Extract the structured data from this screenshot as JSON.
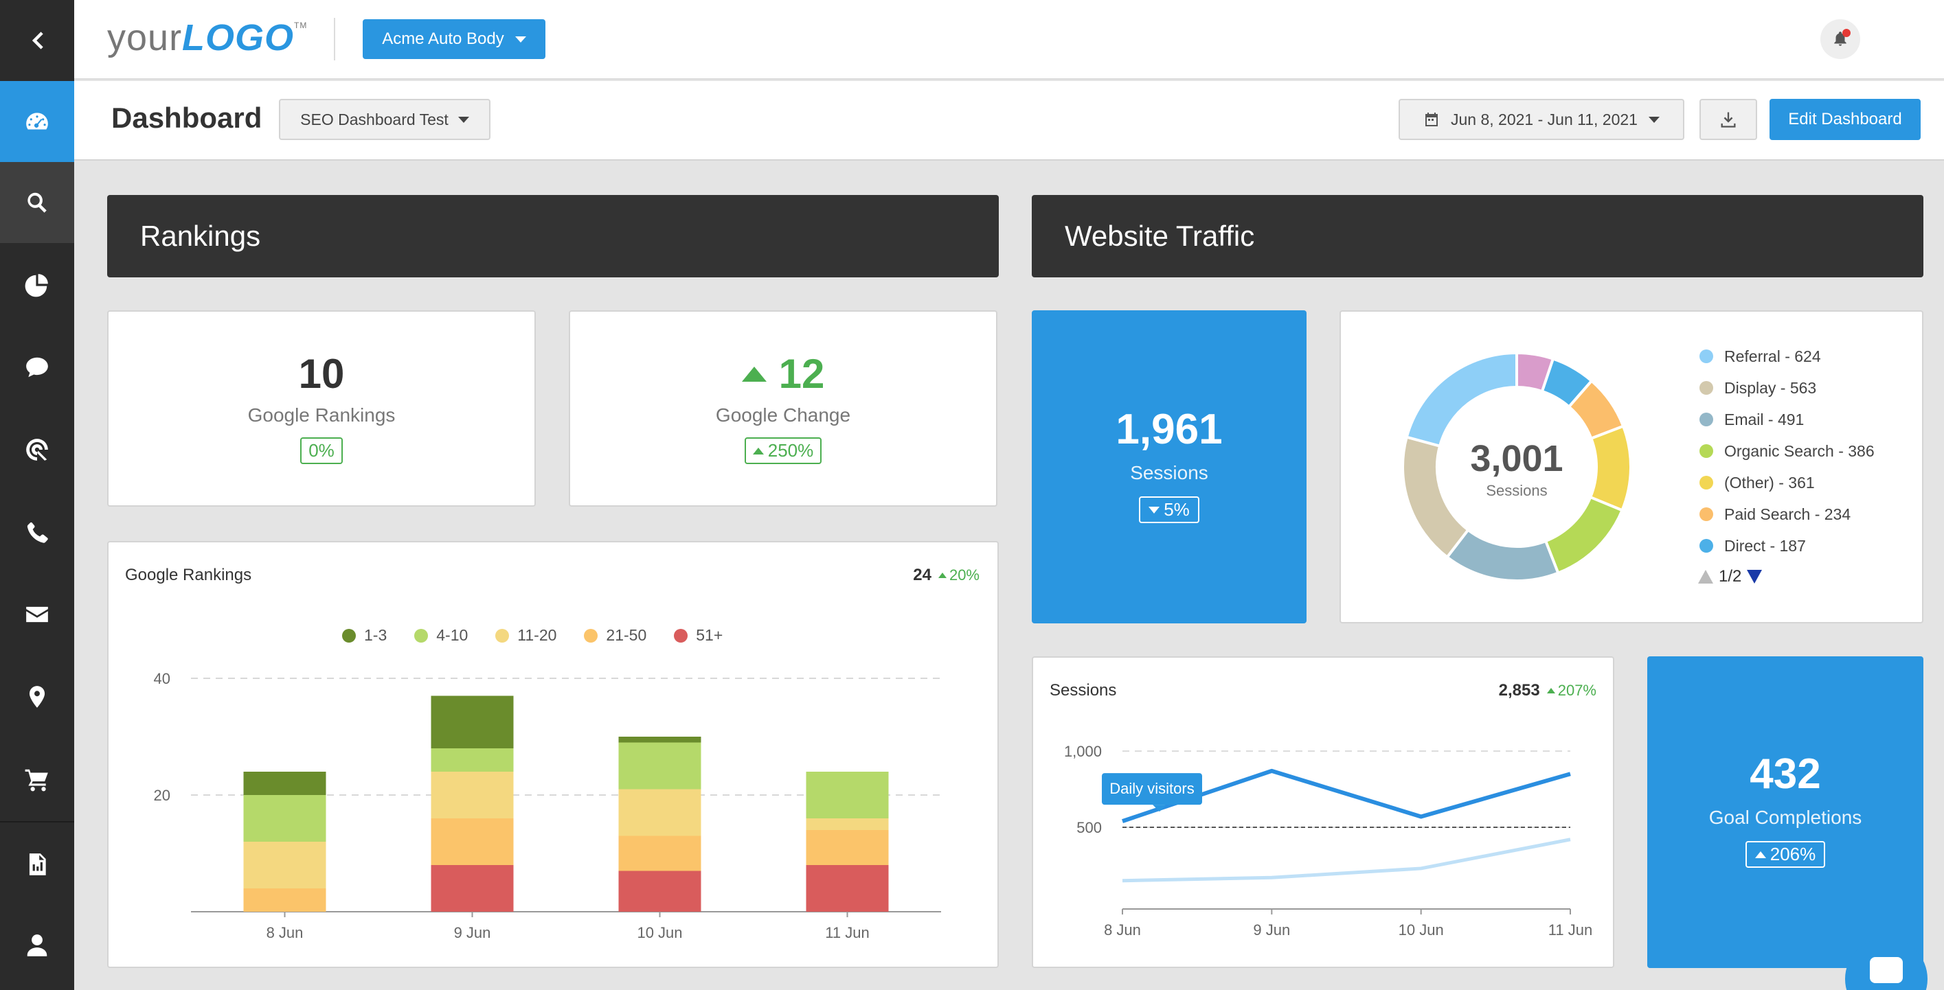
{
  "logo": {
    "text1": "your",
    "text2": "LOGO",
    "tm": "TM"
  },
  "client": {
    "label": "Acme Auto Body"
  },
  "header": {
    "title": "Dashboard",
    "dashboard_select": "SEO Dashboard Test",
    "date_range": "Jun 8, 2021 - Jun 11, 2021",
    "edit_label": "Edit Dashboard"
  },
  "sidebar": {
    "items": [
      {
        "icon": "chevron-left-icon"
      },
      {
        "icon": "dashboard-gauge-icon",
        "active": true
      },
      {
        "icon": "search-icon"
      },
      {
        "icon": "pie-chart-icon"
      },
      {
        "icon": "chat-icon"
      },
      {
        "icon": "target-icon"
      },
      {
        "icon": "phone-icon"
      },
      {
        "icon": "envelope-icon"
      },
      {
        "icon": "map-pin-icon"
      },
      {
        "icon": "cart-icon"
      },
      {
        "icon": "report-icon"
      },
      {
        "icon": "user-icon"
      }
    ]
  },
  "rankings": {
    "section_title": "Rankings",
    "google_rankings": {
      "value": "10",
      "label": "Google Rankings",
      "change": "0%"
    },
    "google_change": {
      "value": "12",
      "label": "Google Change",
      "change": "250%"
    },
    "chart": {
      "title": "Google Rankings",
      "total": "24",
      "change": "20%"
    }
  },
  "traffic": {
    "section_title": "Website Traffic",
    "sessions_card": {
      "value": "1,961",
      "label": "Sessions",
      "change": "5%"
    },
    "donut": {
      "center_value": "3,001",
      "center_label": "Sessions",
      "legend": [
        "Referral - 624",
        "Display - 563",
        "Email - 491",
        "Organic Search - 386",
        "(Other) - 361",
        "Paid Search - 234",
        "Direct - 187"
      ],
      "pager": "1/2"
    },
    "sessions_chart": {
      "title": "Sessions",
      "total": "2,853",
      "change": "207%",
      "tooltip": "Daily visitors"
    },
    "goal_card": {
      "value": "432",
      "label": "Goal Completions",
      "change": "206%"
    }
  },
  "colors": {
    "accent": "#2a96e0",
    "sidebar": "#2b2b2b",
    "section_header": "#333333",
    "positive": "#4caf50"
  },
  "chart_data": [
    {
      "type": "bar",
      "stacked": true,
      "title": "Google Rankings",
      "categories": [
        "8 Jun",
        "9 Jun",
        "10 Jun",
        "11 Jun"
      ],
      "ylim": [
        0,
        40
      ],
      "yticks": [
        "20",
        "40"
      ],
      "legend_placement": "top",
      "series": [
        {
          "name": "1-3",
          "color": "#6a8c2c",
          "values": [
            4,
            9,
            1,
            0
          ]
        },
        {
          "name": "4-10",
          "color": "#b5d96a",
          "values": [
            8,
            4,
            8,
            8
          ]
        },
        {
          "name": "11-20",
          "color": "#f4d880",
          "values": [
            8,
            8,
            8,
            2
          ]
        },
        {
          "name": "21-50",
          "color": "#fbc46a",
          "values": [
            4,
            8,
            6,
            6
          ]
        },
        {
          "name": "51+",
          "color": "#d95c5c",
          "values": [
            0,
            8,
            7,
            8
          ]
        }
      ]
    },
    {
      "type": "pie",
      "donut": true,
      "total": 3001,
      "pager": "1/2",
      "slices": [
        {
          "name": "Referral",
          "value": 624,
          "color": "#8ecff7"
        },
        {
          "name": "Display",
          "value": 563,
          "color": "#d3c9ad"
        },
        {
          "name": "Email",
          "value": 491,
          "color": "#93b7c8"
        },
        {
          "name": "Organic Search",
          "value": 386,
          "color": "#b5d956"
        },
        {
          "name": "(Other)",
          "value": 361,
          "color": "#f2d653"
        },
        {
          "name": "Paid Search",
          "value": 234,
          "color": "#fbbe6b"
        },
        {
          "name": "Direct",
          "value": 187,
          "color": "#4cb0e8"
        },
        {
          "name": "",
          "value": 155,
          "color": "#d99ccb"
        }
      ]
    },
    {
      "type": "line",
      "title": "Sessions",
      "x": [
        "8 Jun",
        "9 Jun",
        "10 Jun",
        "11 Jun"
      ],
      "ylim": [
        0,
        1000
      ],
      "yticks": [
        "500",
        "1,000"
      ],
      "reference_line": 500,
      "series": [
        {
          "color": "#2a8ee0",
          "values": [
            540,
            870,
            570,
            850
          ]
        },
        {
          "color": "#bfe0f7",
          "values": [
            150,
            170,
            230,
            420
          ]
        }
      ]
    }
  ]
}
